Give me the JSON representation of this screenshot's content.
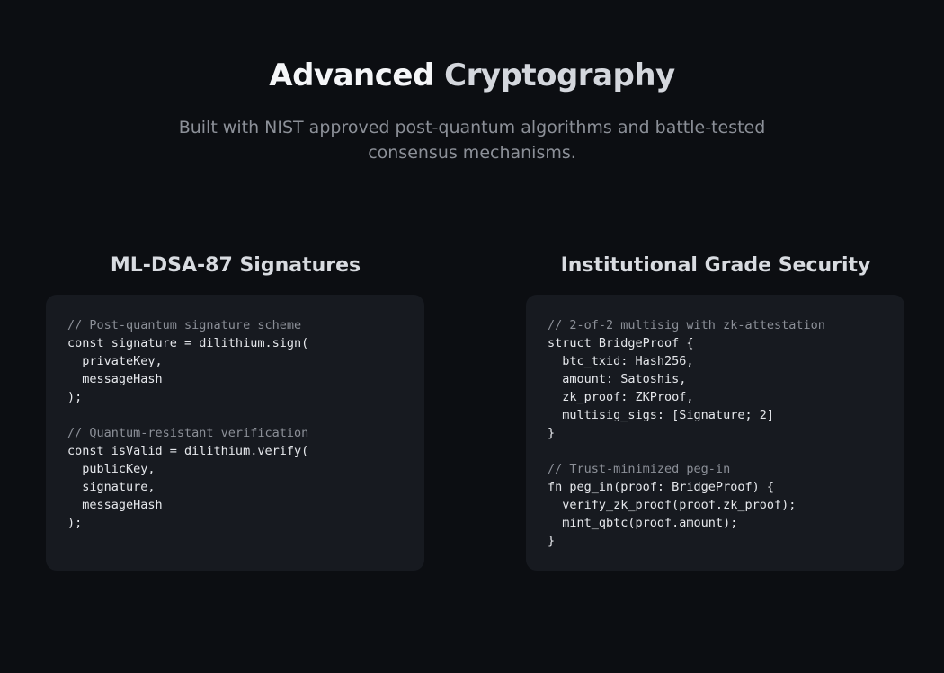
{
  "hero": {
    "title_part1": "Advanced",
    "title_part2": "Cryptography",
    "subtitle": "Built with NIST approved post-quantum algorithms and battle-tested consensus mechanisms."
  },
  "features": [
    {
      "title": "ML-DSA-87 Signatures",
      "code_lines": [
        "// Post-quantum signature scheme",
        "const signature = dilithium.sign(",
        "  privateKey,",
        "  messageHash",
        ");",
        "",
        "// Quantum-resistant verification",
        "const isValid = dilithium.verify(",
        "  publicKey,",
        "  signature,",
        "  messageHash",
        ");"
      ]
    },
    {
      "title": "Institutional Grade Security",
      "code_lines": [
        "// 2-of-2 multisig with zk-attestation",
        "struct BridgeProof {",
        "  btc_txid: Hash256,",
        "  amount: Satoshis,",
        "  zk_proof: ZKProof,",
        "  multisig_sigs: [Signature; 2]",
        "}",
        "",
        "// Trust-minimized peg-in",
        "fn peg_in(proof: BridgeProof) {",
        "  verify_zk_proof(proof.zk_proof);",
        "  mint_qbtc(proof.amount);",
        "}"
      ]
    }
  ]
}
